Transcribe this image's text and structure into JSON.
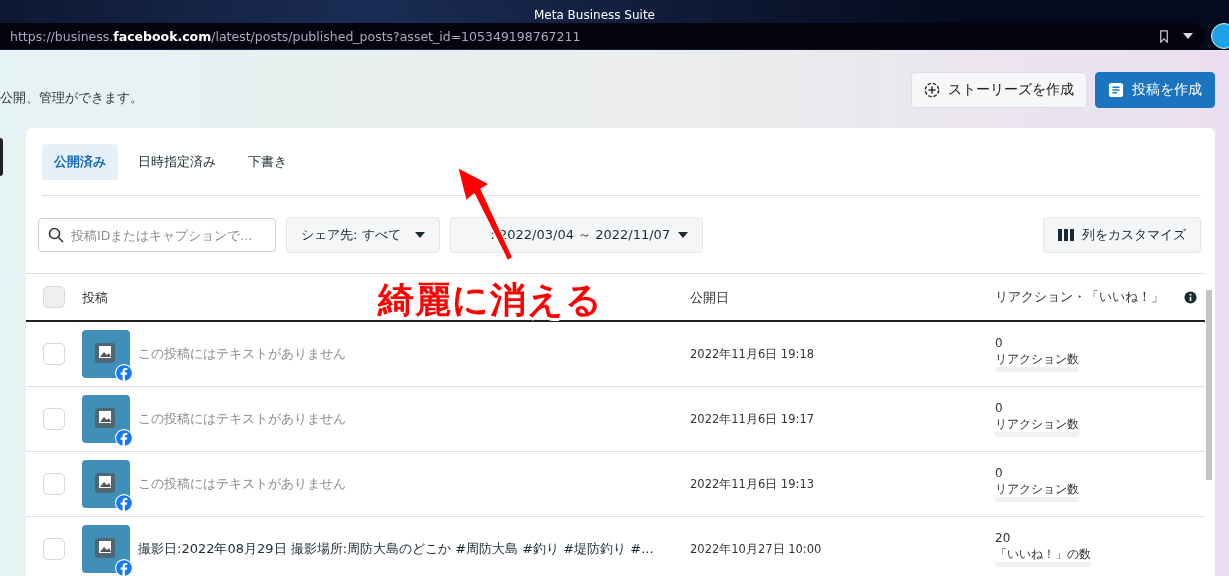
{
  "window": {
    "title": "Meta Business Suite"
  },
  "address_bar": {
    "url": "https://business.**facebook.com**/latest/posts/published_posts?asset_id=105349198767211"
  },
  "page": {
    "description": "公開、管理ができます。"
  },
  "header_buttons": [
    {
      "label": "ストーリーズを作成",
      "kind": "secondary"
    },
    {
      "label": "投稿を作成",
      "kind": "primary"
    }
  ],
  "tabs": [
    {
      "label": "公開済み",
      "selected": true
    },
    {
      "label": "日時指定済み",
      "selected": false
    },
    {
      "label": "下書き",
      "selected": false
    }
  ],
  "filters": {
    "search": {
      "placeholder": "投稿IDまたはキャプションで..."
    },
    "share_to": "シェア先: すべて",
    "date_range": ": 2022/03/04 ～ 2022/11/07",
    "customize": "列をカスタマイズ"
  },
  "table": {
    "columns": [
      "投稿",
      "公開日",
      "リアクション・「いいね！」"
    ],
    "header_checked": false,
    "rows": [
      {
        "checked": false,
        "caption": "この投稿にはテキストがありません",
        "has_text": false,
        "date": "2022年11月6日 19:18",
        "count": "0",
        "count_label": "リアクション数"
      },
      {
        "checked": false,
        "caption": "この投稿にはテキストがありません",
        "has_text": false,
        "date": "2022年11月6日 19:17",
        "count": "0",
        "count_label": "リアクション数"
      },
      {
        "checked": false,
        "caption": "この投稿にはテキストがありません",
        "has_text": false,
        "date": "2022年11月6日 19:13",
        "count": "0",
        "count_label": "リアクション数"
      },
      {
        "checked": false,
        "caption": "撮影日:2022年08月29日 撮影場所:周防大島のどこか #周防大島 #釣り #堤防釣り #...",
        "has_text": true,
        "date": "2022年10月27日 10:00",
        "count": "20",
        "count_label": "「いいね！」の数"
      }
    ]
  },
  "annotation": {
    "text": "綺麗に消える"
  }
}
